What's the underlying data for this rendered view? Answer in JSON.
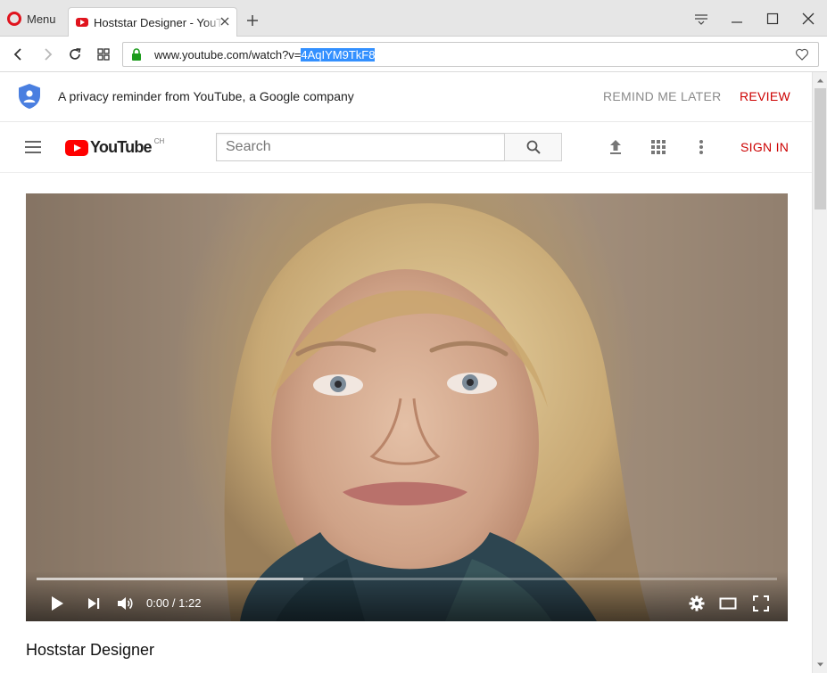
{
  "browser": {
    "menu_label": "Menu",
    "tab": {
      "title": "Hoststar Designer - YouTube"
    },
    "url": {
      "base": "www.youtube.com/watch?v=",
      "selected": "4AqIYM9TkF8"
    },
    "colors": {
      "opera_red": "#e0141e",
      "selection_blue": "#3390ff",
      "lock_green": "#1e9c1e"
    }
  },
  "privacy_bar": {
    "text": "A privacy reminder from YouTube, a Google company",
    "remind_label": "REMIND ME LATER",
    "review_label": "REVIEW"
  },
  "youtube_header": {
    "logo_word": "YouTube",
    "country_code": "CH",
    "search_placeholder": "Search",
    "signin_label": "SIGN IN",
    "colors": {
      "brand_red": "#ff0000",
      "link_red": "#cc0000"
    }
  },
  "player": {
    "time_current": "0:00",
    "time_sep": " / ",
    "time_total": "1:22",
    "loaded_fraction": 0.36
  },
  "video": {
    "title": "Hoststar Designer"
  }
}
